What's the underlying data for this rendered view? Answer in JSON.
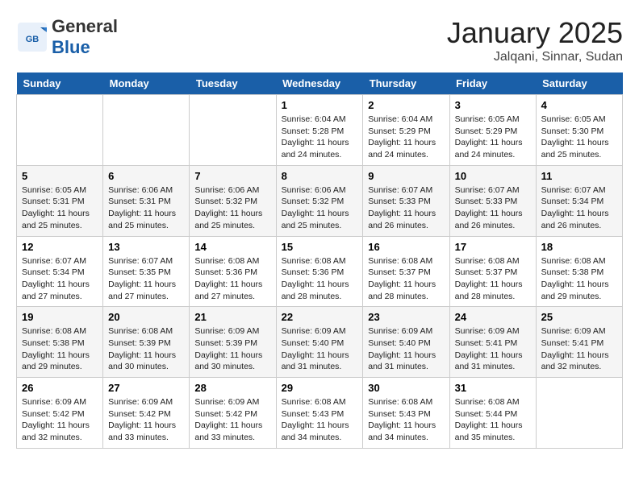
{
  "header": {
    "logo_general": "General",
    "logo_blue": "Blue",
    "month": "January 2025",
    "location": "Jalqani, Sinnar, Sudan"
  },
  "weekdays": [
    "Sunday",
    "Monday",
    "Tuesday",
    "Wednesday",
    "Thursday",
    "Friday",
    "Saturday"
  ],
  "weeks": [
    [
      {
        "day": "",
        "info": ""
      },
      {
        "day": "",
        "info": ""
      },
      {
        "day": "",
        "info": ""
      },
      {
        "day": "1",
        "info": "Sunrise: 6:04 AM\nSunset: 5:28 PM\nDaylight: 11 hours\nand 24 minutes."
      },
      {
        "day": "2",
        "info": "Sunrise: 6:04 AM\nSunset: 5:29 PM\nDaylight: 11 hours\nand 24 minutes."
      },
      {
        "day": "3",
        "info": "Sunrise: 6:05 AM\nSunset: 5:29 PM\nDaylight: 11 hours\nand 24 minutes."
      },
      {
        "day": "4",
        "info": "Sunrise: 6:05 AM\nSunset: 5:30 PM\nDaylight: 11 hours\nand 25 minutes."
      }
    ],
    [
      {
        "day": "5",
        "info": "Sunrise: 6:05 AM\nSunset: 5:31 PM\nDaylight: 11 hours\nand 25 minutes."
      },
      {
        "day": "6",
        "info": "Sunrise: 6:06 AM\nSunset: 5:31 PM\nDaylight: 11 hours\nand 25 minutes."
      },
      {
        "day": "7",
        "info": "Sunrise: 6:06 AM\nSunset: 5:32 PM\nDaylight: 11 hours\nand 25 minutes."
      },
      {
        "day": "8",
        "info": "Sunrise: 6:06 AM\nSunset: 5:32 PM\nDaylight: 11 hours\nand 25 minutes."
      },
      {
        "day": "9",
        "info": "Sunrise: 6:07 AM\nSunset: 5:33 PM\nDaylight: 11 hours\nand 26 minutes."
      },
      {
        "day": "10",
        "info": "Sunrise: 6:07 AM\nSunset: 5:33 PM\nDaylight: 11 hours\nand 26 minutes."
      },
      {
        "day": "11",
        "info": "Sunrise: 6:07 AM\nSunset: 5:34 PM\nDaylight: 11 hours\nand 26 minutes."
      }
    ],
    [
      {
        "day": "12",
        "info": "Sunrise: 6:07 AM\nSunset: 5:34 PM\nDaylight: 11 hours\nand 27 minutes."
      },
      {
        "day": "13",
        "info": "Sunrise: 6:07 AM\nSunset: 5:35 PM\nDaylight: 11 hours\nand 27 minutes."
      },
      {
        "day": "14",
        "info": "Sunrise: 6:08 AM\nSunset: 5:36 PM\nDaylight: 11 hours\nand 27 minutes."
      },
      {
        "day": "15",
        "info": "Sunrise: 6:08 AM\nSunset: 5:36 PM\nDaylight: 11 hours\nand 28 minutes."
      },
      {
        "day": "16",
        "info": "Sunrise: 6:08 AM\nSunset: 5:37 PM\nDaylight: 11 hours\nand 28 minutes."
      },
      {
        "day": "17",
        "info": "Sunrise: 6:08 AM\nSunset: 5:37 PM\nDaylight: 11 hours\nand 28 minutes."
      },
      {
        "day": "18",
        "info": "Sunrise: 6:08 AM\nSunset: 5:38 PM\nDaylight: 11 hours\nand 29 minutes."
      }
    ],
    [
      {
        "day": "19",
        "info": "Sunrise: 6:08 AM\nSunset: 5:38 PM\nDaylight: 11 hours\nand 29 minutes."
      },
      {
        "day": "20",
        "info": "Sunrise: 6:08 AM\nSunset: 5:39 PM\nDaylight: 11 hours\nand 30 minutes."
      },
      {
        "day": "21",
        "info": "Sunrise: 6:09 AM\nSunset: 5:39 PM\nDaylight: 11 hours\nand 30 minutes."
      },
      {
        "day": "22",
        "info": "Sunrise: 6:09 AM\nSunset: 5:40 PM\nDaylight: 11 hours\nand 31 minutes."
      },
      {
        "day": "23",
        "info": "Sunrise: 6:09 AM\nSunset: 5:40 PM\nDaylight: 11 hours\nand 31 minutes."
      },
      {
        "day": "24",
        "info": "Sunrise: 6:09 AM\nSunset: 5:41 PM\nDaylight: 11 hours\nand 31 minutes."
      },
      {
        "day": "25",
        "info": "Sunrise: 6:09 AM\nSunset: 5:41 PM\nDaylight: 11 hours\nand 32 minutes."
      }
    ],
    [
      {
        "day": "26",
        "info": "Sunrise: 6:09 AM\nSunset: 5:42 PM\nDaylight: 11 hours\nand 32 minutes."
      },
      {
        "day": "27",
        "info": "Sunrise: 6:09 AM\nSunset: 5:42 PM\nDaylight: 11 hours\nand 33 minutes."
      },
      {
        "day": "28",
        "info": "Sunrise: 6:09 AM\nSunset: 5:42 PM\nDaylight: 11 hours\nand 33 minutes."
      },
      {
        "day": "29",
        "info": "Sunrise: 6:08 AM\nSunset: 5:43 PM\nDaylight: 11 hours\nand 34 minutes."
      },
      {
        "day": "30",
        "info": "Sunrise: 6:08 AM\nSunset: 5:43 PM\nDaylight: 11 hours\nand 34 minutes."
      },
      {
        "day": "31",
        "info": "Sunrise: 6:08 AM\nSunset: 5:44 PM\nDaylight: 11 hours\nand 35 minutes."
      },
      {
        "day": "",
        "info": ""
      }
    ]
  ]
}
